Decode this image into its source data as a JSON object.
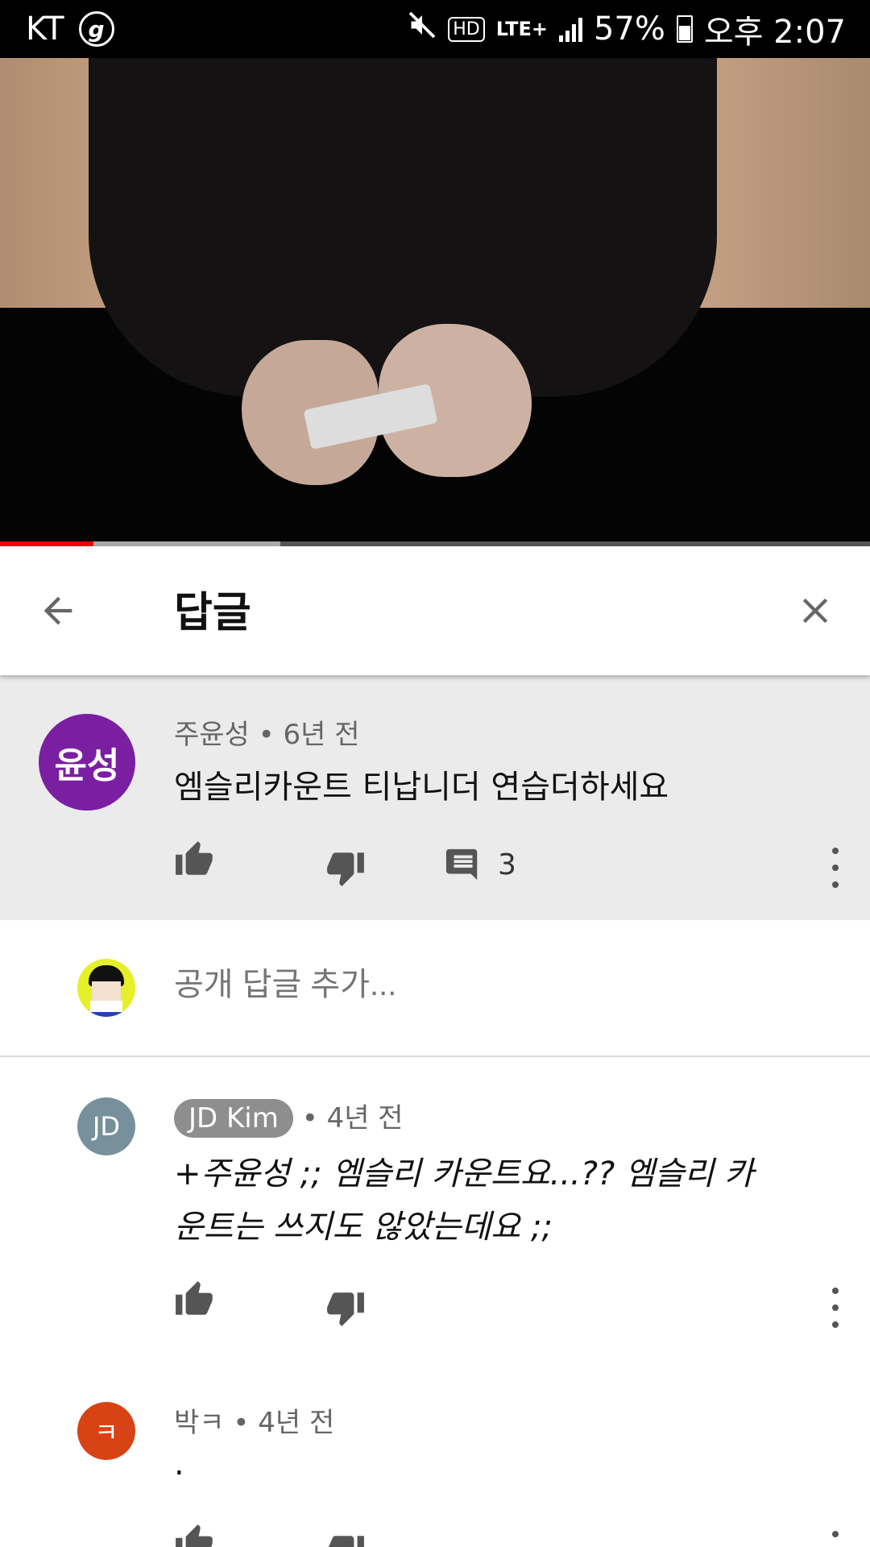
{
  "status_bar": {
    "carrier": "KT",
    "g_badge": "g",
    "hd": "HD",
    "network": "LTE+",
    "battery": "57%",
    "time": "오후 2:07"
  },
  "video": {
    "progress_played": 0.107,
    "progress_buffered": 0.322
  },
  "header": {
    "title": "답글"
  },
  "parent_comment": {
    "avatar_text": "윤성",
    "avatar_color": "#7b1fa2",
    "author": "주윤성",
    "time": "6년 전",
    "text": "엠슬리카운트 티납니더 연습더하세요",
    "reply_count": "3"
  },
  "add_reply": {
    "placeholder": "공개 답글 추가..."
  },
  "replies": [
    {
      "avatar_text": "JD",
      "avatar_color": "#78909c",
      "author": "JD Kim",
      "time": "4년 전",
      "text": "+주윤성 ;; 엠슬리 카운트요...?? 엠슬리 카운트는 쓰지도 않았는데요 ;;"
    },
    {
      "avatar_text": "ㅋ",
      "avatar_color": "#d84315",
      "author": "박ㅋ",
      "time": "4년 전",
      "text": "."
    }
  ],
  "separator": "•"
}
